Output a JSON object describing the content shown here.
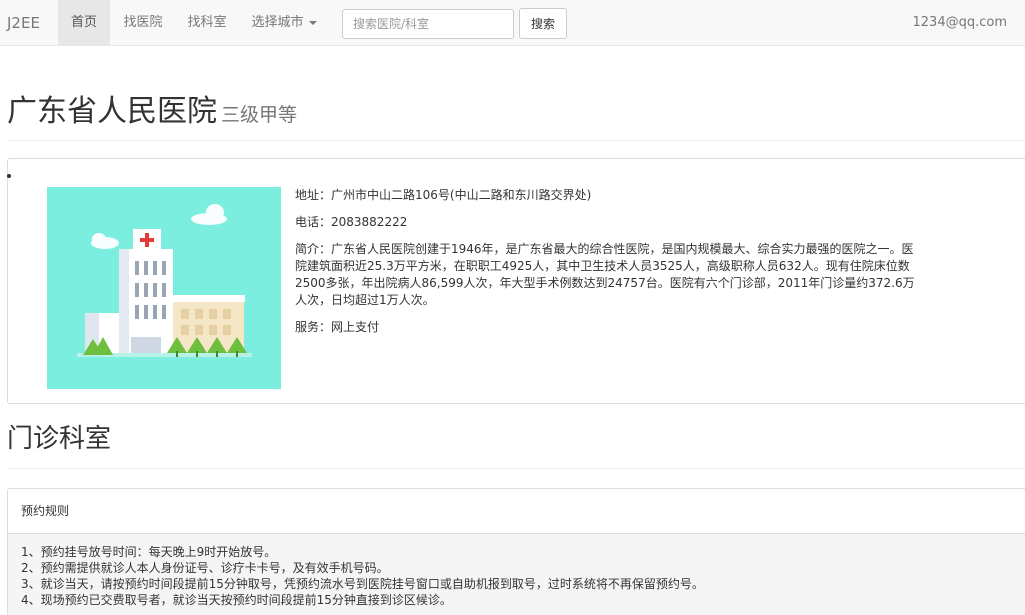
{
  "navbar": {
    "brand": "J2EE",
    "items": [
      {
        "label": "首页",
        "active": true
      },
      {
        "label": "找医院"
      },
      {
        "label": "找科室"
      },
      {
        "label": "选择城市"
      }
    ],
    "search_placeholder": "搜索医院/科室",
    "search_button": "搜索",
    "user": "1234@qq.com"
  },
  "hospital": {
    "name": "广东省人民医院",
    "level": "三级甲等",
    "address": "地址：广州市中山二路106号(中山二路和东川路交界处)",
    "phone": "电话：2083882222",
    "intro": "简介：广东省人民医院创建于1946年，是广东省最大的综合性医院，是国内规模最大、综合实力最强的医院之一。医院建筑面积近25.3万平方米，在职职工4925人，其中卫生技术人员3525人，高级职称人员632人。现有住院床位数2500多张，年出院病人86,599人次，年大型手术例数达到24757台。医院有六个门诊部，2011年门诊量约372.6万人次，日均超过1万人次。",
    "service": "服务：网上支付"
  },
  "departments": {
    "title": "门诊科室"
  },
  "rules": {
    "title": "预约规则",
    "items": [
      "1、预约挂号放号时间：每天晚上9时开始放号。",
      "2、预约需提供就诊人本人身份证号、诊疗卡卡号，及有效手机号码。",
      "3、就诊当天，请按预约时间段提前15分钟取号，凭预约流水号到医院挂号窗口或自助机报到取号，过时系统将不再保留预约号。",
      "4、现场预约已交费取号者，就诊当天按预约时间段提前15分钟直接到诊区候诊。"
    ]
  },
  "colors": {
    "navbar_bg": "#f8f8f8",
    "image_bg": "#7ceedf",
    "cross": "#e53935"
  }
}
